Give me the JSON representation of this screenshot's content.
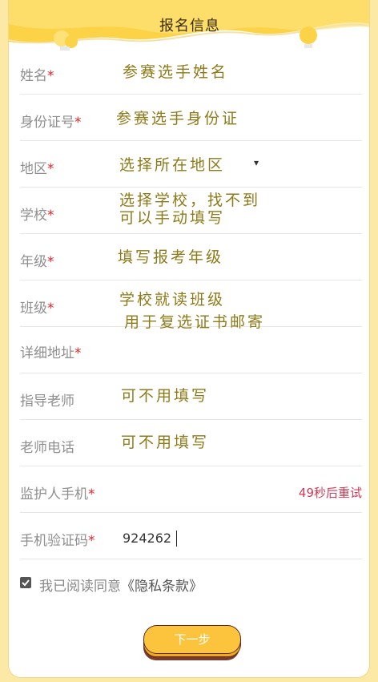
{
  "header": {
    "title": "报名信息"
  },
  "form": {
    "rows": [
      {
        "label": "姓名",
        "required": true,
        "hint": "参赛选手姓名"
      },
      {
        "label": "身份证号",
        "required": true,
        "hint": "参赛选手身份证"
      },
      {
        "label": "地区",
        "required": true,
        "hint": "选择所在地区",
        "dropdown_icon": "▾"
      },
      {
        "label": "学校",
        "required": true,
        "hint_lines": [
          "选择学校，找不到",
          "可以手动填写"
        ]
      },
      {
        "label": "年级",
        "required": true,
        "hint": "填写报考年级"
      },
      {
        "label": "班级",
        "required": true,
        "hint_lines": [
          "学校就读班级",
          "用于复选证书邮寄"
        ]
      },
      {
        "label": "详细地址",
        "required": true
      },
      {
        "label": "指导老师",
        "required": false,
        "hint": "可不用填写"
      },
      {
        "label": "老师电话",
        "required": false,
        "hint": "可不用填写"
      },
      {
        "label": "监护人手机",
        "required": true,
        "timer": "49秒后重试"
      },
      {
        "label": "手机验证码",
        "required": true,
        "value": "924262"
      }
    ],
    "required_mark": "*"
  },
  "agreement": {
    "checked": true,
    "text": "我已阅读同意",
    "link": "《隐私条款》"
  },
  "next_button": {
    "label": "下一步"
  },
  "colors": {
    "background": "#fde9a6",
    "header_yellow": "#fcd247",
    "required": "#e1252b",
    "hint": "#8d7a18",
    "timer": "#d23a55",
    "button": "#fcc43c"
  }
}
